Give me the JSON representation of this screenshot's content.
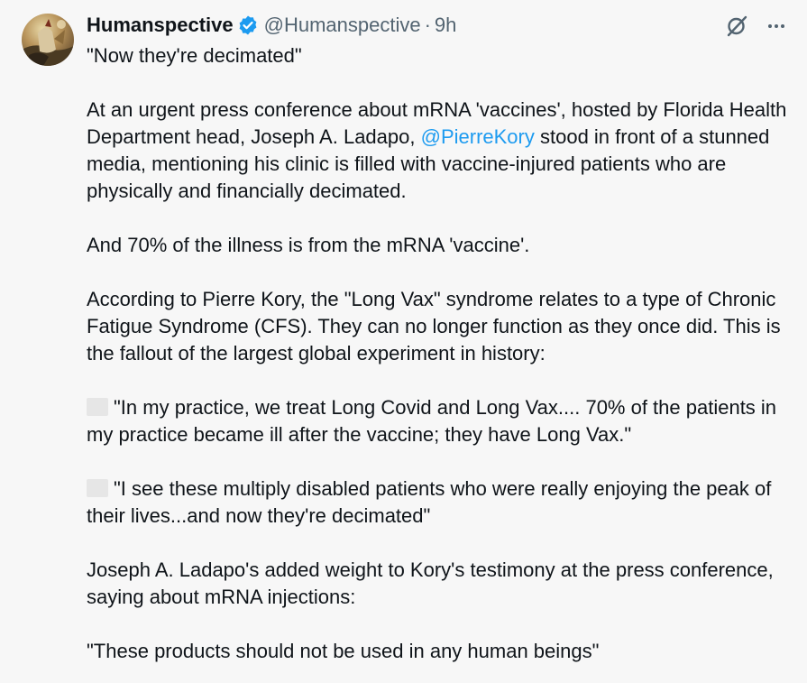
{
  "author": {
    "display_name": "Humanspective",
    "handle": "@Humanspective",
    "separator": "·",
    "time": "9h",
    "verified_icon": "verified-badge-icon",
    "avatar": "avatar-painting"
  },
  "actions": {
    "grok_icon": "grok-icon",
    "more_icon": "more-options-icon"
  },
  "body": {
    "p1": "\"Now they're decimated\"",
    "p2_before": "At an urgent press conference about mRNA 'vaccines', hosted by Florida Health Department head, Joseph A. Ladapo, ",
    "p2_mention": "@PierreKory",
    "p2_after": " stood in front of a stunned media, mentioning his clinic is filled with vaccine-injured patients who are physically and financially decimated.",
    "p3": "And 70% of the illness is from the mRNA 'vaccine'.",
    "p4": "According to Pierre Kory, the \"Long Vax\" syndrome relates to a type of Chronic Fatigue Syndrome (CFS). They can no longer function as they once did. This is the fallout of the largest global experiment in history:",
    "p5": "\"In my practice, we treat Long Covid and Long Vax.... 70% of the patients in my practice became ill after the vaccine; they have Long Vax.\"",
    "p6": "\"I see these multiply disabled patients who were really enjoying the peak of their lives...and now they're decimated\"",
    "p7": "Joseph A. Ladapo's added weight to Kory's testimony at the press conference, saying about mRNA injections:",
    "p8": "\"These products should not be used in any human beings\""
  },
  "colors": {
    "background": "#f7f7f7",
    "text": "#0f1419",
    "secondary": "#536471",
    "accent": "#1d9bf0"
  }
}
